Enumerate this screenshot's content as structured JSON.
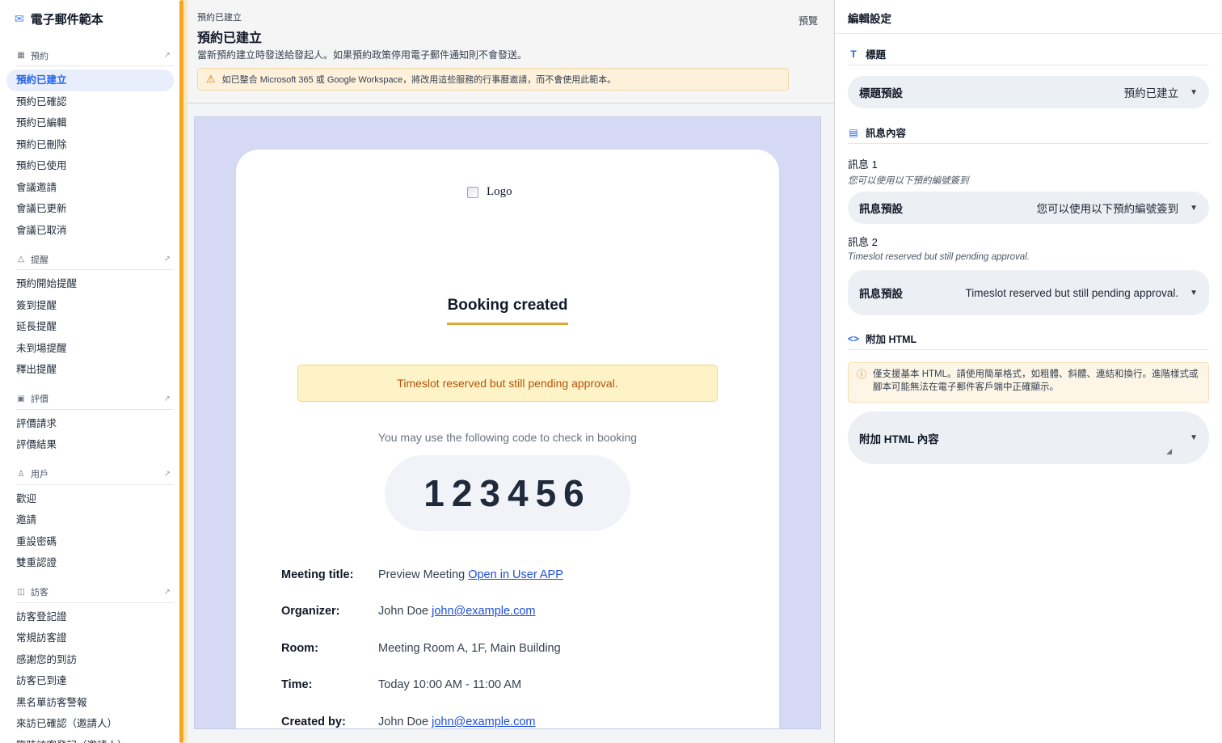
{
  "sidebar": {
    "title": "電子郵件範本",
    "title_icon": "mail-icon",
    "sections": [
      {
        "label": "預約",
        "icon": "calendar-icon",
        "items": [
          "預約已建立",
          "預約已確認",
          "預約已編輯",
          "預約已刪除",
          "預約已使用",
          "會議邀請",
          "會議已更新",
          "會議已取消"
        ]
      },
      {
        "label": "提醒",
        "icon": "bell-icon",
        "items": [
          "預約開始提醒",
          "簽到提醒",
          "延長提醒",
          "未到場提醒",
          "釋出提醒"
        ]
      },
      {
        "label": "評價",
        "icon": "rating-icon",
        "items": [
          "評價請求",
          "評價結果"
        ]
      },
      {
        "label": "用戶",
        "icon": "user-icon",
        "items": [
          "歡迎",
          "邀請",
          "重設密碼",
          "雙重認證"
        ]
      },
      {
        "label": "訪客",
        "icon": "visitor-icon",
        "items": [
          "訪客登記證",
          "常規訪客證",
          "感謝您的到訪",
          "訪客已到達",
          "黑名單訪客警報",
          "來訪已確認（邀請人）",
          "臨時訪客登記（邀請人）"
        ]
      }
    ],
    "active_item": "預約已建立"
  },
  "header": {
    "breadcrumb": "預約已建立",
    "title": "預約已建立",
    "description": "當新預約建立時發送給發起人。如果預約政策停用電子郵件通知則不會發送。",
    "preview_label": "預覽",
    "warning": "如已整合 Microsoft 365 或 Google Workspace，將改用這些服務的行事曆邀請，而不會使用此範本。"
  },
  "email": {
    "logo_alt": "Logo",
    "title": "Booking created",
    "pending_notice": "Timeslot reserved but still pending approval.",
    "code_caption": "You may use the following code to check in booking",
    "code": "123456",
    "details": [
      {
        "key": "Meeting title:",
        "value": "Preview Meeting",
        "link": "Open in User APP"
      },
      {
        "key": "Organizer:",
        "value": "John Doe",
        "link": "john@example.com"
      },
      {
        "key": "Room:",
        "value": "Meeting Room A, 1F, Main Building",
        "link": ""
      },
      {
        "key": "Time:",
        "value": "Today 10:00 AM - 11:00 AM",
        "link": ""
      },
      {
        "key": "Created by:",
        "value": "John Doe",
        "link": "john@example.com"
      }
    ]
  },
  "settings": {
    "title": "編輯設定",
    "heading_section": "標題",
    "heading_preset_label": "標題預設",
    "heading_preset_value": "預約已建立",
    "message_section": "訊息內容",
    "message1_label": "訊息 1",
    "message1_hint": "您可以使用以下預約編號簽到",
    "message1_preset_label": "訊息預設",
    "message1_preset_value": "您可以使用以下預約編號簽到",
    "message2_label": "訊息 2",
    "message2_hint": "Timeslot reserved but still pending approval.",
    "message2_preset_label": "訊息預設",
    "message2_preset_value": "Timeslot reserved but still pending approval.",
    "html_section": "附加 HTML",
    "html_note": "僅支援基本 HTML。請使用簡單格式，如粗體、斜體、連結和換行。進階樣式或腳本可能無法在電子郵件客戶端中正確顯示。",
    "html_content_label": "附加 HTML 內容"
  },
  "colors": {
    "accent": "#2563eb",
    "sidebar_edge": "#f5a623",
    "canvas": "#d5d9f4",
    "underline": "#e0a82e"
  }
}
